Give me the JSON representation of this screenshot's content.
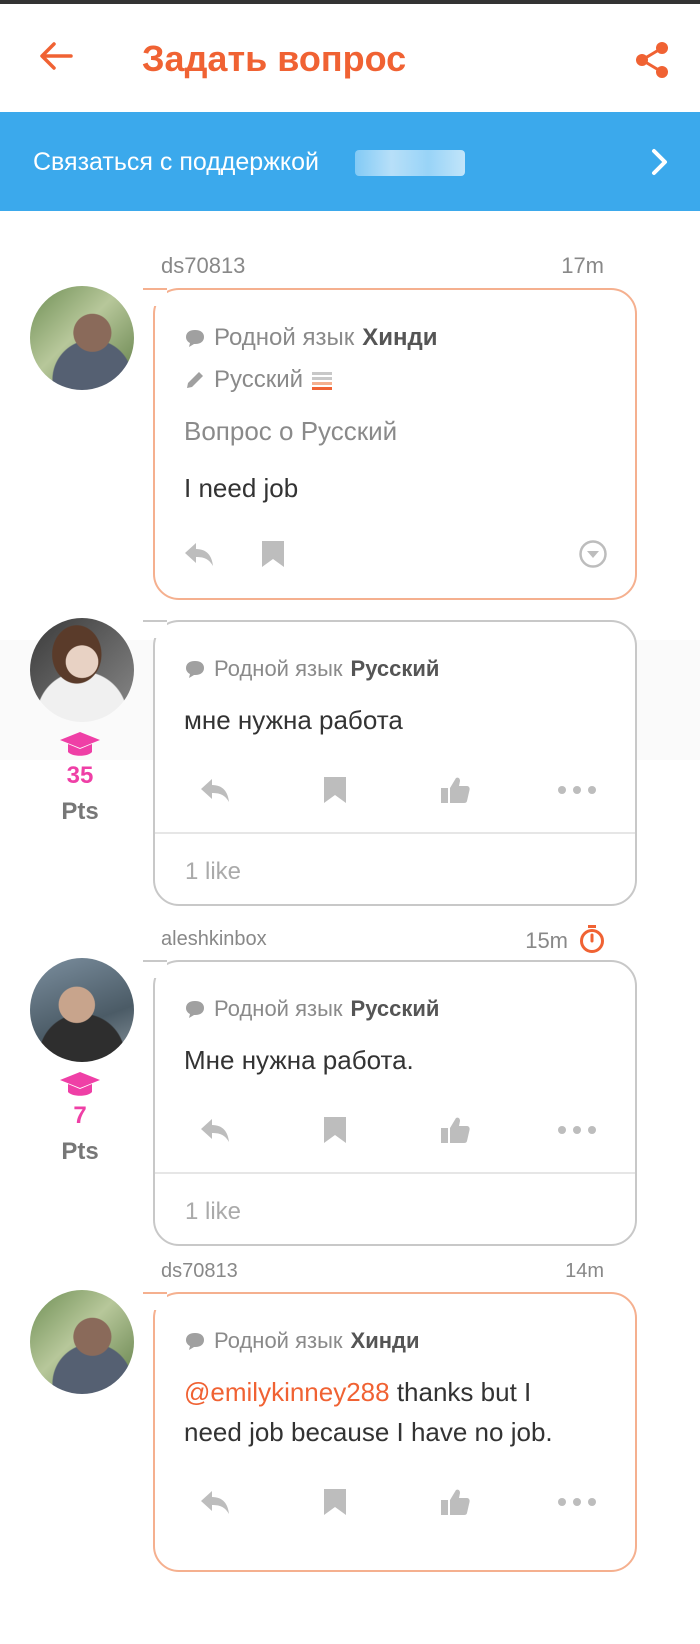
{
  "header": {
    "title": "Задать вопрос"
  },
  "support": {
    "label": "Связаться с поддержкой"
  },
  "posts": [
    {
      "user": "ds70813",
      "time": "17m",
      "native_prefix": "Родной язык",
      "native_lang": "Хинди",
      "learning_lang": "Русский",
      "question_about": "Вопрос о Русский",
      "text": "I need job"
    },
    {
      "native_prefix": "Родной язык",
      "native_lang": "Русский",
      "text": "мне нужна работа",
      "points": "35",
      "points_label": "Pts",
      "likes": "1 like"
    },
    {
      "user": "aleshkinbox",
      "time": "15m",
      "native_prefix": "Родной язык",
      "native_lang": "Русский",
      "text": "Мне нужна работа.",
      "points": "7",
      "points_label": "Pts",
      "likes": "1 like"
    },
    {
      "user": "ds70813",
      "time": "14m",
      "native_prefix": "Родной язык",
      "native_lang": "Хинди",
      "mention": "@emilykinney288",
      "text_after_mention": " thanks but I",
      "text_line2": "need job because I have no job."
    }
  ],
  "colors": {
    "accent": "#f06233",
    "banner": "#3ba9ec",
    "points": "#ef3fa6"
  }
}
